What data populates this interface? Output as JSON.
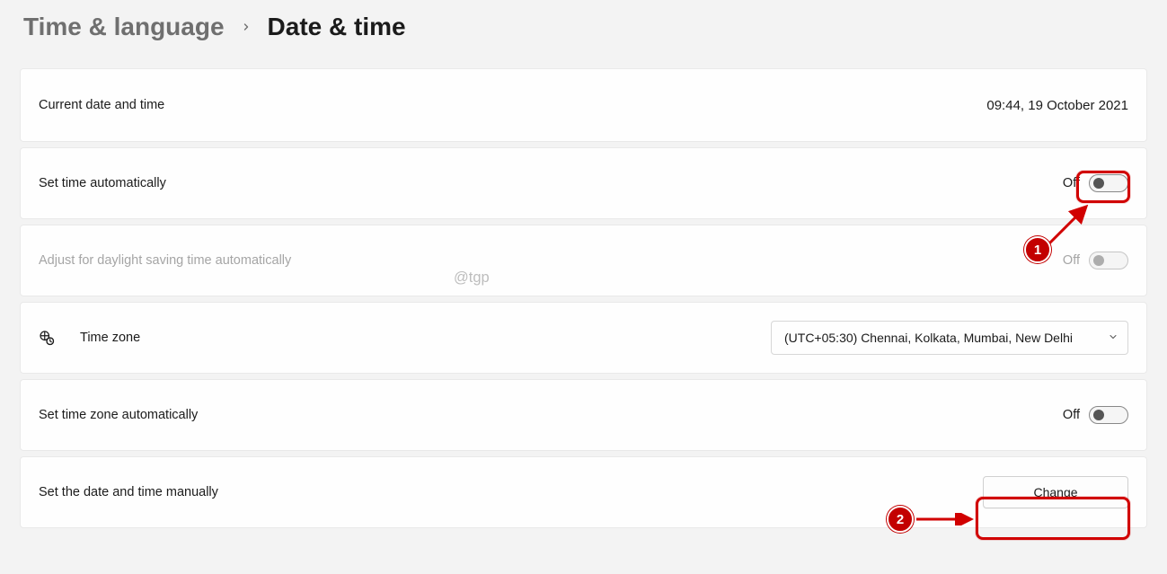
{
  "breadcrumb": {
    "parent": "Time & language",
    "current": "Date & time"
  },
  "rows": {
    "current": {
      "label": "Current date and time",
      "value": "09:44, 19 October 2021"
    },
    "auto_time": {
      "label": "Set time automatically",
      "state": "Off"
    },
    "dst": {
      "label": "Adjust for daylight saving time automatically",
      "state": "Off"
    },
    "timezone": {
      "label": "Time zone",
      "selected": "(UTC+05:30) Chennai, Kolkata, Mumbai, New Delhi"
    },
    "auto_tz": {
      "label": "Set time zone automatically",
      "state": "Off"
    },
    "manual": {
      "label": "Set the date and time manually",
      "button": "Change"
    }
  },
  "watermark": "@tgp",
  "annotations": {
    "badge1": "1",
    "badge2": "2"
  }
}
